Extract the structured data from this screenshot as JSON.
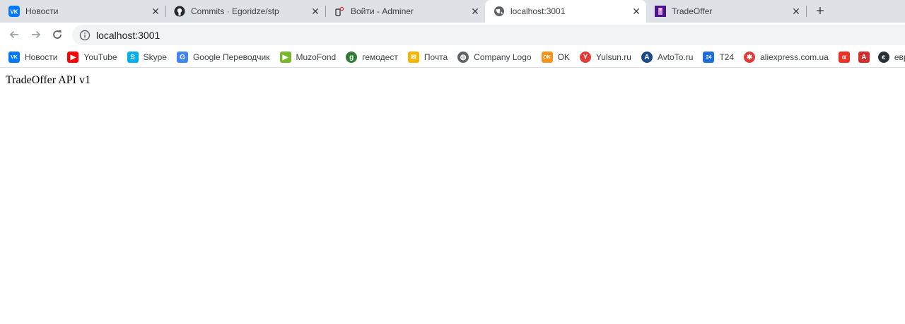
{
  "tabs": [
    {
      "title": "Новости",
      "icon": "vk-icon",
      "color": "#0077ff"
    },
    {
      "title": "Commits · Egoridze/stp",
      "icon": "github-icon",
      "color": "#24292e"
    },
    {
      "title": "Войти - Adminer",
      "icon": "adminer-icon",
      "color": "#e53935"
    },
    {
      "title": "localhost:3001",
      "icon": "globe-icon",
      "color": "#5f6368"
    },
    {
      "title": "TradeOffer",
      "icon": "tradeoffer-icon",
      "color": "#6a1b9a"
    }
  ],
  "toolbar": {
    "url": "localhost:3001"
  },
  "bookmarks": [
    {
      "label": "Новости",
      "icon": "vk-icon",
      "color": "#0077ff",
      "glyph": "VK"
    },
    {
      "label": "YouTube",
      "icon": "youtube-icon",
      "color": "#ff0000",
      "glyph": "▶"
    },
    {
      "label": "Skype",
      "icon": "skype-icon",
      "color": "#00aff0",
      "glyph": "S"
    },
    {
      "label": "Google Переводчик",
      "icon": "google-translate-icon",
      "color": "#4285f4",
      "glyph": "G"
    },
    {
      "label": "MuzoFond",
      "icon": "muzofond-icon",
      "color": "#76b82a",
      "glyph": "▶"
    },
    {
      "label": "гемодест",
      "icon": "gemodest-icon",
      "color": "#2e7d32",
      "glyph": "g"
    },
    {
      "label": "Почта",
      "icon": "mail-icon",
      "color": "#f4b400",
      "glyph": "✉"
    },
    {
      "label": "Company Logo",
      "icon": "globe-icon",
      "color": "#5f6368",
      "glyph": "◍"
    },
    {
      "label": "OK",
      "icon": "ok-icon",
      "color": "#f7931e",
      "glyph": "OK"
    },
    {
      "label": "Yulsun.ru",
      "icon": "yulsun-icon",
      "color": "#e53935",
      "glyph": "Y"
    },
    {
      "label": "AvtoTo.ru",
      "icon": "avtoto-icon",
      "color": "#1a4a8a",
      "glyph": "A"
    },
    {
      "label": "T24",
      "icon": "t24-icon",
      "color": "#1e6fd9",
      "glyph": "24"
    },
    {
      "label": "aliexpress.com.ua",
      "icon": "aliexpress-icon",
      "color": "#e53935",
      "glyph": "✱"
    },
    {
      "label": "",
      "icon": "alfa-icon",
      "color": "#ef3124",
      "glyph": "α"
    },
    {
      "label": "",
      "icon": "acrobat-icon",
      "color": "#d32f2f",
      "glyph": "A"
    },
    {
      "label": "евро",
      "icon": "euro-icon",
      "color": "#263238",
      "glyph": "є"
    }
  ],
  "content": {
    "text": "TradeOffer API v1"
  }
}
